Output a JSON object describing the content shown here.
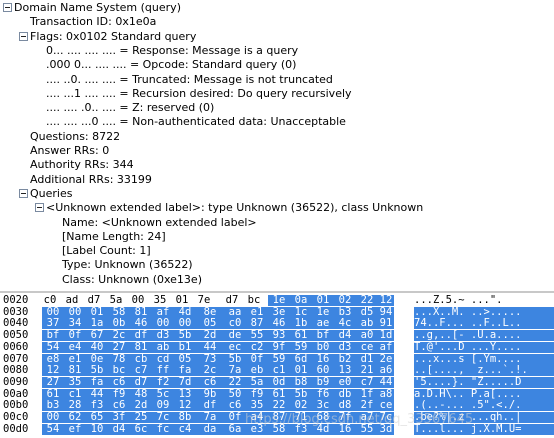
{
  "tree": [
    {
      "text": "Domain Name System (query)",
      "indent": 0,
      "toggle": true
    },
    {
      "text": "Transaction ID: 0x1e0a",
      "indent": 1
    },
    {
      "text": "Flags: 0x0102 Standard query",
      "indent": 1,
      "toggle": true
    },
    {
      "text": "0... .... .... .... = Response: Message is a query",
      "indent": 3
    },
    {
      "text": ".000 0... .... .... = Opcode: Standard query (0)",
      "indent": 3
    },
    {
      "text": ".... ..0. .... .... = Truncated: Message is not truncated",
      "indent": 3
    },
    {
      "text": ".... ...1 .... .... = Recursion desired: Do query recursively",
      "indent": 3
    },
    {
      "text": ".... .... .0.. .... = Z: reserved (0)",
      "indent": 3
    },
    {
      "text": ".... .... ...0 .... = Non-authenticated data: Unacceptable",
      "indent": 3
    },
    {
      "text": "Questions: 8722",
      "indent": 1
    },
    {
      "text": "Answer RRs: 0",
      "indent": 1
    },
    {
      "text": "Authority RRs: 344",
      "indent": 1
    },
    {
      "text": "Additional RRs: 33199",
      "indent": 1
    },
    {
      "text": "Queries",
      "indent": 1,
      "toggle": true
    },
    {
      "text": "<Unknown extended label>: type Unknown (36522), class Unknown",
      "indent": 2,
      "toggle": true
    },
    {
      "text": "Name: <Unknown extended label>",
      "indent": 4
    },
    {
      "text": "[Name Length: 24]",
      "indent": 4
    },
    {
      "text": "[Label Count: 1]",
      "indent": 4
    },
    {
      "text": "Type: Unknown (36522)",
      "indent": 4
    },
    {
      "text": "Class: Unknown (0xe13e)",
      "indent": 4
    }
  ],
  "hex": [
    {
      "offset": "0020",
      "bytes": [
        "c0",
        "ad",
        "d7",
        "5a",
        "00",
        "35",
        "01",
        "7e",
        "d7",
        "bc",
        "1e",
        "0a",
        "01",
        "02",
        "22",
        "12"
      ],
      "sel_from": 10,
      "ascii": "...Z.5.~ ...\"."
    },
    {
      "offset": "0030",
      "bytes": [
        "00",
        "00",
        "01",
        "58",
        "81",
        "af",
        "4d",
        "8e",
        "aa",
        "e1",
        "3e",
        "1c",
        "1e",
        "b3",
        "d5",
        "94"
      ],
      "sel_from": 0,
      "ascii": "...X..M. ..>....."
    },
    {
      "offset": "0040",
      "bytes": [
        "37",
        "34",
        "1a",
        "0b",
        "46",
        "00",
        "00",
        "05",
        "c0",
        "87",
        "46",
        "1b",
        "ae",
        "4c",
        "ab",
        "91"
      ],
      "sel_from": 0,
      "ascii": "74..F... ..F..L.."
    },
    {
      "offset": "0050",
      "bytes": [
        "bf",
        "0f",
        "67",
        "2c",
        "df",
        "d3",
        "5b",
        "2d",
        "de",
        "55",
        "93",
        "61",
        "bf",
        "d4",
        "a0",
        "1d"
      ],
      "sel_from": 0,
      "ascii": "..g,..[- .U.a...."
    },
    {
      "offset": "0060",
      "bytes": [
        "54",
        "e4",
        "40",
        "27",
        "81",
        "ab",
        "b1",
        "44",
        "ec",
        "c2",
        "9f",
        "59",
        "b0",
        "d3",
        "ce",
        "af"
      ],
      "sel_from": 0,
      "ascii": "T.@'...D ...Y...."
    },
    {
      "offset": "0070",
      "bytes": [
        "e8",
        "e1",
        "0e",
        "78",
        "cb",
        "cd",
        "05",
        "73",
        "5b",
        "0f",
        "59",
        "6d",
        "16",
        "b2",
        "d1",
        "2e"
      ],
      "sel_from": 0,
      "ascii": "...x...s [.Ym...."
    },
    {
      "offset": "0080",
      "bytes": [
        "12",
        "81",
        "5b",
        "bc",
        "c7",
        "ff",
        "fa",
        "2c",
        "7a",
        "eb",
        "c1",
        "01",
        "60",
        "13",
        "21",
        "a6"
      ],
      "sel_from": 0,
      "ascii": "..[....,  z...`.!."
    },
    {
      "offset": "0090",
      "bytes": [
        "27",
        "35",
        "fa",
        "c6",
        "d7",
        "f2",
        "7d",
        "c6",
        "22",
        "5a",
        "0d",
        "b8",
        "b9",
        "e0",
        "c7",
        "44"
      ],
      "sel_from": 0,
      "ascii": "'5....}. \"Z.....D"
    },
    {
      "offset": "00a0",
      "bytes": [
        "61",
        "c1",
        "44",
        "f9",
        "48",
        "5c",
        "13",
        "9b",
        "50",
        "f9",
        "61",
        "5b",
        "f6",
        "db",
        "1f",
        "a8"
      ],
      "sel_from": 0,
      "ascii": "a.D.H\\.. P.a[...."
    },
    {
      "offset": "00b0",
      "bytes": [
        "b3",
        "28",
        "f3",
        "c6",
        "2d",
        "09",
        "12",
        "df",
        "c6",
        "35",
        "22",
        "02",
        "3c",
        "d8",
        "2f",
        "ce"
      ],
      "sel_from": 0,
      "ascii": ".(..-... .5\".<./."
    },
    {
      "offset": "00c0",
      "bytes": [
        "00",
        "62",
        "65",
        "3f",
        "25",
        "7c",
        "8b",
        "7a",
        "0f",
        "a4",
        "87",
        "71",
        "68",
        "7f",
        "a7",
        "7c"
      ],
      "sel_from": 0,
      "ascii": ".be?%|.z ...qh..|"
    },
    {
      "offset": "00d0",
      "bytes": [
        "54",
        "ef",
        "10",
        "d4",
        "6c",
        "fc",
        "c4",
        "da",
        "6a",
        "e3",
        "58",
        "f3",
        "4d",
        "16",
        "55",
        "3d"
      ],
      "sel_from": 0,
      "ascii": "T...l... j.X.M.U="
    }
  ],
  "watermark": "https://blog.csdn.net/qq_33567645",
  "colors": {
    "selection": "#3d85e0",
    "toggle_border": "#7a8aa0"
  }
}
